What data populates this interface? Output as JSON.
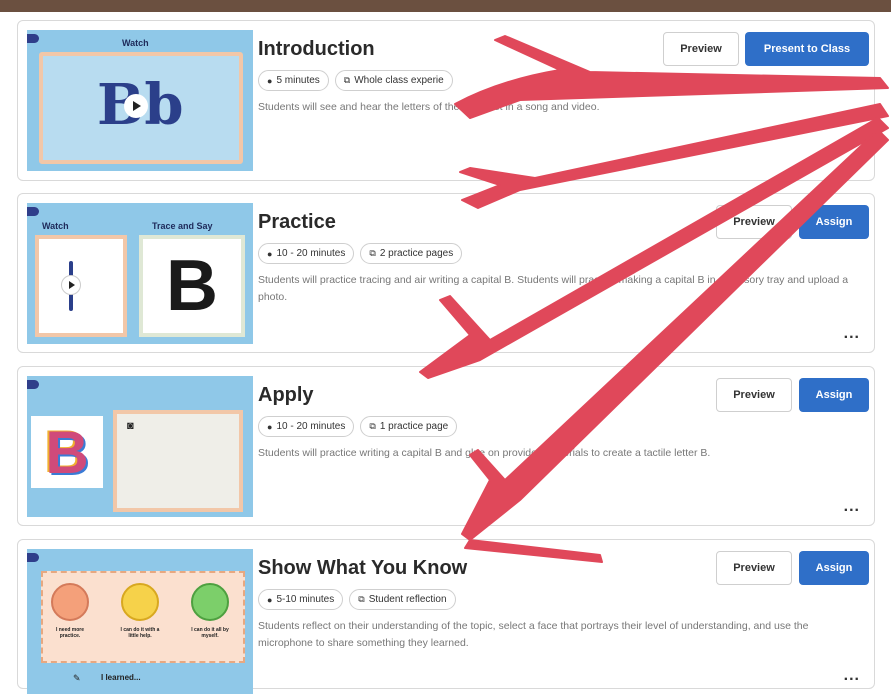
{
  "cards": [
    {
      "title": "Introduction",
      "chips": [
        "5 minutes",
        "Whole class experie"
      ],
      "description": "Students will see and hear the letters of the alphabet in a song and video.",
      "thumb": {
        "label": "Watch",
        "letter": "Bb"
      },
      "buttons": [
        "Preview",
        "Present to Class"
      ],
      "more": "..."
    },
    {
      "title": "Practice",
      "chips": [
        "10 - 20 minutes",
        "2 practice pages"
      ],
      "description": "Students will practice tracing and air writing a capital B. Students will practice making a capital B in a sensory tray and upload a photo.",
      "thumb": {
        "label_left": "Watch",
        "label_right": "Trace and Say",
        "letter": "B"
      },
      "buttons": [
        "Preview",
        "Assign"
      ],
      "more": "..."
    },
    {
      "title": "Apply",
      "chips": [
        "10 - 20 minutes",
        "1 practice page"
      ],
      "description": "Students will practice writing a capital B and glue on provided materials to create a tactile letter B.",
      "thumb": {
        "letter": "B"
      },
      "buttons": [
        "Preview",
        "Assign"
      ],
      "more": "..."
    },
    {
      "title": "Show What You Know",
      "chips": [
        "5-10 minutes",
        "Student reflection"
      ],
      "description": "Students reflect on their understanding of the topic, select a face that portrays their level of understanding, and use the microphone to share something they learned.",
      "thumb": {
        "faces": [
          "I need more practice.",
          "I can do it with a little help.",
          "I can do it all by myself."
        ],
        "learned": "I learned..."
      },
      "buttons": [
        "Preview",
        "Assign"
      ],
      "more": "..."
    }
  ],
  "colors": {
    "primary_button": "#2f6fc8",
    "annotation_arrow": "#e0485a",
    "top_bar": "#6b5040",
    "thumb_bg": "#8fc8e8"
  }
}
